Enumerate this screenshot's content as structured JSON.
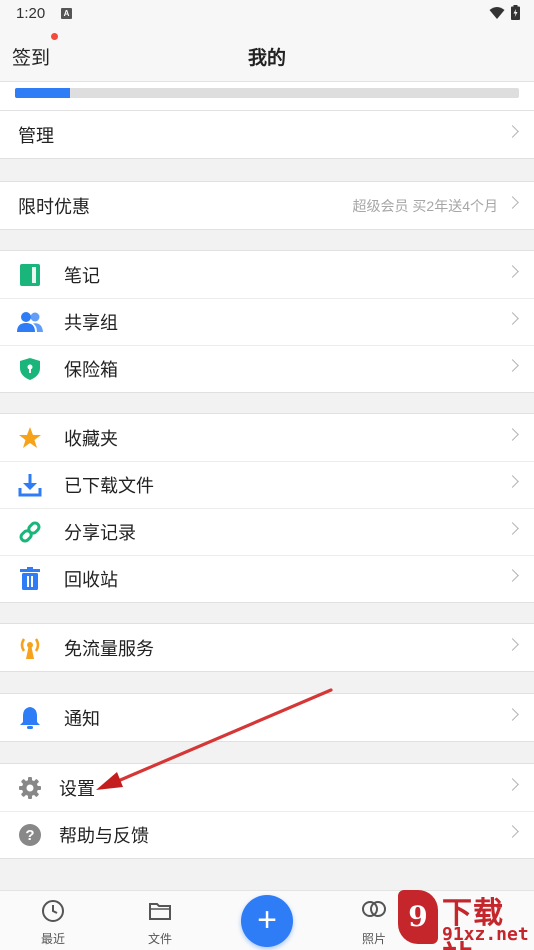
{
  "status_bar": {
    "time": "1:20",
    "indicator": "A"
  },
  "header": {
    "signin_label": "签到",
    "title": "我的"
  },
  "storage": {
    "used_fraction": 0.11
  },
  "groups": {
    "manage": {
      "label": "管理"
    },
    "promo": {
      "label": "限时优惠",
      "hint": "超级会员 买2年送4个月"
    },
    "tools": [
      {
        "label": "笔记",
        "icon": "notebook-icon",
        "color": "#1ab57a"
      },
      {
        "label": "共享组",
        "icon": "users-icon",
        "color": "#2e7cf6"
      },
      {
        "label": "保险箱",
        "icon": "shield-icon",
        "color": "#1ab57a"
      }
    ],
    "files": [
      {
        "label": "收藏夹",
        "icon": "star-icon",
        "color": "#f7a21b"
      },
      {
        "label": "已下载文件",
        "icon": "download-icon",
        "color": "#2e7cf6"
      },
      {
        "label": "分享记录",
        "icon": "link-icon",
        "color": "#1ab57a"
      },
      {
        "label": "回收站",
        "icon": "trash-icon",
        "color": "#2e7cf6"
      }
    ],
    "traffic": [
      {
        "label": "免流量服务",
        "icon": "antenna-icon",
        "color": "#f7a21b"
      }
    ],
    "notify": [
      {
        "label": "通知",
        "icon": "bell-icon",
        "color": "#2e7cf6"
      }
    ],
    "system": [
      {
        "label": "设置",
        "icon": "gear-icon",
        "color": "#888888"
      },
      {
        "label": "帮助与反馈",
        "icon": "help-icon",
        "color": "#888888"
      }
    ]
  },
  "bottom_nav": {
    "recent": "最近",
    "files": "文件",
    "add": "+",
    "photos": "照片"
  },
  "watermark": {
    "logo": "9",
    "title": "下载站",
    "url": "91xz.net"
  },
  "colors": {
    "accent": "#2e7cf6",
    "badge": "#f24a3b",
    "annotation_arrow": "#d62424"
  }
}
